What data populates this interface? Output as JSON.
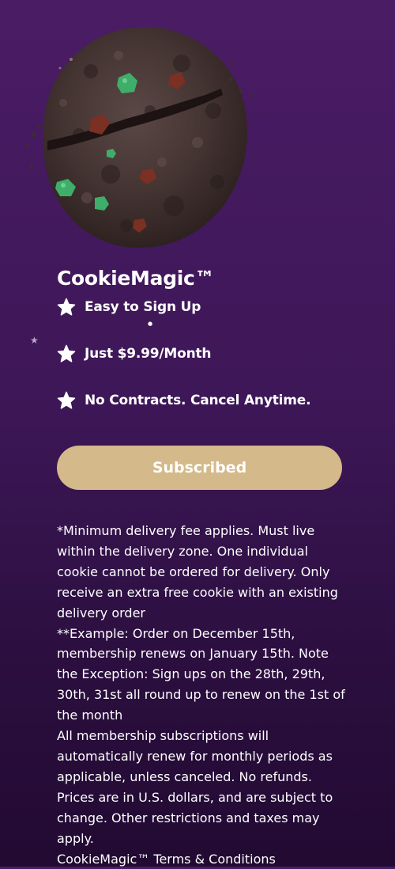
{
  "brand": {
    "title": "CookieMagic™"
  },
  "features": [
    {
      "icon": "star-icon",
      "label": "Easy to Sign Up"
    },
    {
      "icon": "star-icon",
      "label": "Just $9.99/Month"
    },
    {
      "icon": "star-icon",
      "label": "No Contracts. Cancel Anytime."
    }
  ],
  "subscribe_button": {
    "label": "Subscribed"
  },
  "fineprint": {
    "delivery_note": "*Minimum delivery fee applies. Must live within the delivery zone. One individual cookie cannot be ordered for delivery. Only receive an extra free cookie with an existing delivery order",
    "example_note": "**Example: Order on December 15th, membership renews on January 15th. Note the Exception: Sign ups on the 28th, 29th, 30th, 31st all round up to renew on the 1st of the month",
    "renewal_note": "All membership subscriptions will automatically renew for monthly periods as applicable, unless canceled. No refunds. Prices are in U.S. dollars, and are subject to change. Other restrictions and taxes may apply.",
    "terms_link": "CookieMagic™ Terms & Conditions"
  },
  "colors": {
    "background_top": "#4a1c64",
    "background_bottom": "#220a32",
    "button": "#d4b98a",
    "text": "#ffffff"
  },
  "hero_image": "cookie-image"
}
